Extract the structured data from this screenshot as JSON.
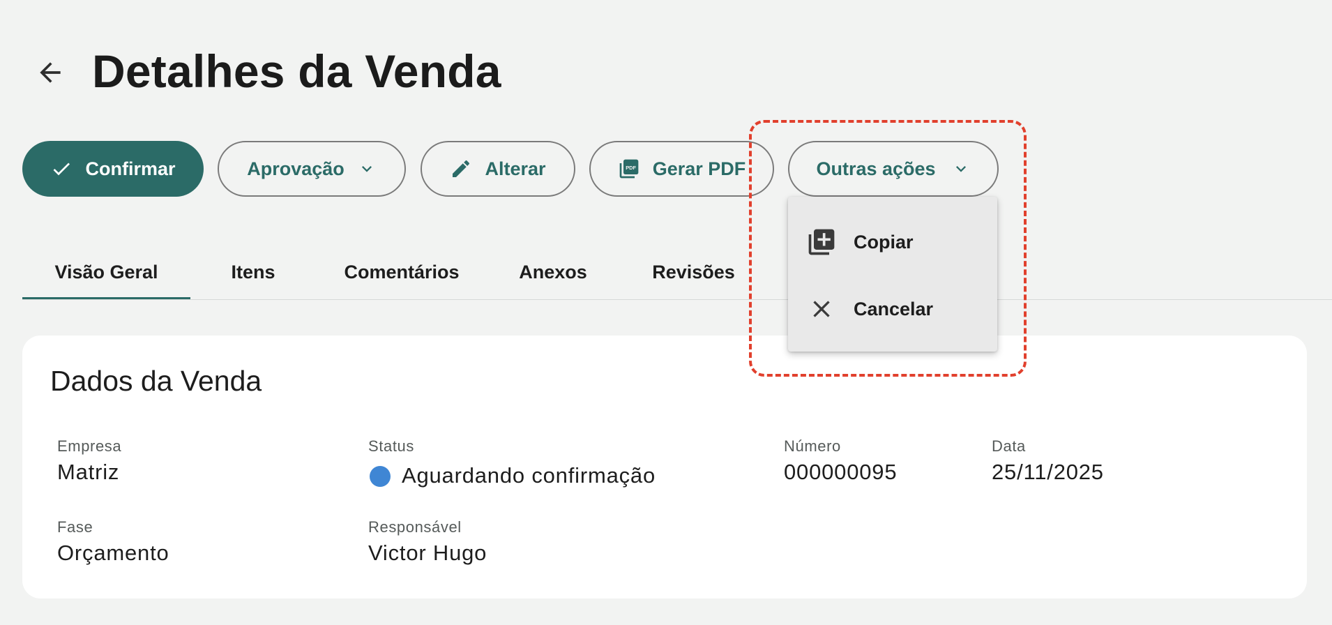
{
  "header": {
    "title": "Detalhes da Venda"
  },
  "toolbar": {
    "confirm_label": "Confirmar",
    "approval_label": "Aprovação",
    "edit_label": "Alterar",
    "pdf_label": "Gerar PDF",
    "more_label": "Outras ações",
    "primary_color": "#2b6b67"
  },
  "menu": {
    "items": [
      {
        "label": "Copiar",
        "icon": "copy-add-icon"
      },
      {
        "label": "Cancelar",
        "icon": "close-icon"
      }
    ]
  },
  "tabs": [
    {
      "label": "Visão Geral",
      "active": true
    },
    {
      "label": "Itens"
    },
    {
      "label": "Comentários"
    },
    {
      "label": "Anexos"
    },
    {
      "label": "Revisões"
    }
  ],
  "card": {
    "title": "Dados da Venda",
    "fields": {
      "empresa": {
        "label": "Empresa",
        "value": "Matriz"
      },
      "status": {
        "label": "Status",
        "value": "Aguardando confirmação",
        "color": "#3f86d4"
      },
      "numero": {
        "label": "Número",
        "value": "000000095"
      },
      "data": {
        "label": "Data",
        "value": "25/11/2025"
      },
      "fase": {
        "label": "Fase",
        "value": "Orçamento"
      },
      "responsavel": {
        "label": "Responsável",
        "value": "Victor Hugo"
      }
    }
  }
}
